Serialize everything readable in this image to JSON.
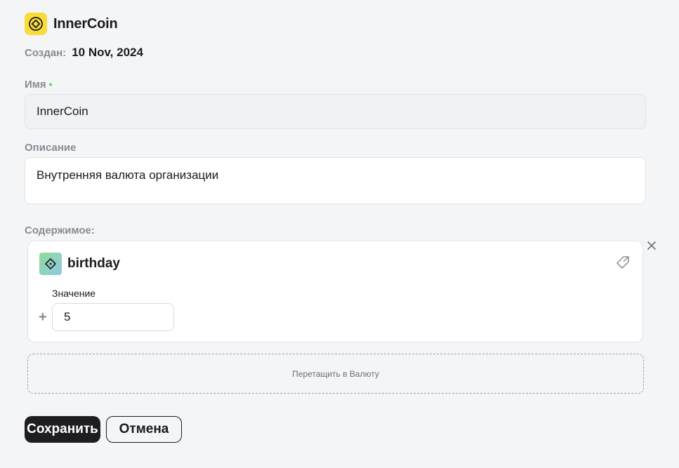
{
  "header": {
    "icon": "currency-icon",
    "title": "InnerCoin",
    "accent_color": "#f7dc3a"
  },
  "created": {
    "label": "Создан:",
    "value": "10 Nov, 2024"
  },
  "name_field": {
    "label": "Имя",
    "required_mark": "•",
    "value": "InnerCoin"
  },
  "description_field": {
    "label": "Описание",
    "value": "Внутренняя валюта организации"
  },
  "content": {
    "label": "Содержимое:",
    "items": [
      {
        "icon": "item-diamond-icon",
        "title": "birthday",
        "value_label": "Значение",
        "sign": "+",
        "value": "5"
      }
    ]
  },
  "dropzone": {
    "text": "Перетащить в Валюту"
  },
  "actions": {
    "save_label": "Сохранить",
    "cancel_label": "Отмена"
  }
}
